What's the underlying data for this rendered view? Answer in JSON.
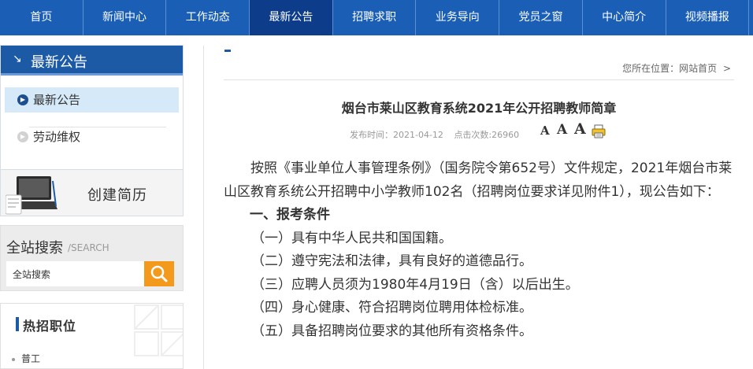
{
  "nav": {
    "items": [
      "首页",
      "新闻中心",
      "工作动态",
      "最新公告",
      "招聘求职",
      "业务导向",
      "党员之窗",
      "中心简介",
      "视频播报"
    ],
    "active_index": 3
  },
  "sidebar": {
    "category_title": "最新公告",
    "items": [
      {
        "label": "最新公告",
        "selected": true
      },
      {
        "label": "劳动维权",
        "selected": false
      }
    ]
  },
  "resume": {
    "title": "创建简历"
  },
  "search": {
    "title": "全站搜索",
    "subtitle": "/SEARCH",
    "value": "全站搜索"
  },
  "hot_jobs": {
    "title": "热招职位",
    "items": [
      "普工"
    ]
  },
  "breadcrumb": {
    "text": "您所在位置：网站首页",
    "arrow": ">"
  },
  "article": {
    "title": "烟台市莱山区教育系统2021年公开招聘教师简章",
    "publish_label": "发布时间：2021-04-12",
    "clicks_label": "点击次数:26960",
    "font_sizes": [
      "A",
      "A",
      "A"
    ],
    "paragraphs": [
      {
        "type": "indent",
        "text": "按照《事业单位人事管理条例》（国务院令第652号）文件规定，2021年烟台市莱山区教育系统公开招聘中小学教师102名（招聘岗位要求详见附件1），现公告如下："
      },
      {
        "type": "sec",
        "text": "一、报考条件"
      },
      {
        "type": "item",
        "text": "（一）具有中华人民共和国国籍。"
      },
      {
        "type": "item",
        "text": "（二）遵守宪法和法律，具有良好的道德品行。"
      },
      {
        "type": "item",
        "text": "（三）应聘人员须为1980年4月19日（含）以后出生。"
      },
      {
        "type": "item",
        "text": "（四）身心健康、符合招聘岗位聘用体检标准。"
      },
      {
        "type": "item",
        "text": "（五）具备招聘岗位要求的其他所有资格条件。"
      }
    ]
  },
  "colors": {
    "nav_bg": "#1a5eb5",
    "nav_active": "#0d3d8a",
    "sidebar_header": "#1c5aa6",
    "search_button": "#f39a1c",
    "selected_item_bg": "#d5e9f8"
  }
}
